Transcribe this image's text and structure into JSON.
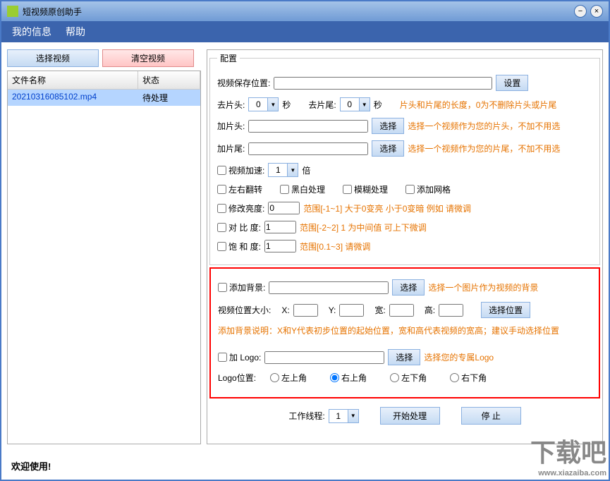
{
  "app": {
    "title": "短视频原创助手"
  },
  "menu": {
    "info": "我的信息",
    "help": "帮助"
  },
  "left": {
    "select_video": "选择视频",
    "clear_video": "清空视频",
    "col_filename": "文件名称",
    "col_status": "状态",
    "file_name": "20210316085102.mp4",
    "file_status": "待处理"
  },
  "cfg": {
    "legend": "配置",
    "save_path_label": "视频保存位置:",
    "save_path": "",
    "set_btn": "设置",
    "cut_head_label": "去片头:",
    "cut_head_val": "0",
    "sec": "秒",
    "cut_tail_label": "去片尾:",
    "cut_tail_val": "0",
    "cut_hint": "片头和片尾的长度，0为不删除片头或片尾",
    "add_head_label": "加片头:",
    "add_head_val": "",
    "select_btn": "选择",
    "add_head_hint": "选择一个视频作为您的片头，不加不用选",
    "add_tail_label": "加片尾:",
    "add_tail_val": "",
    "add_tail_hint": "选择一个视频作为您的片尾，不加不用选",
    "speed_label": "视频加速:",
    "speed_val": "1",
    "speed_unit": "倍",
    "flip": "左右翻转",
    "bw": "黑白处理",
    "blur": "模糊处理",
    "grid": "添加网格",
    "brightness_label": "修改亮度:",
    "brightness_val": "0",
    "brightness_hint": "范围[-1~1]    大于0变亮 小于0变暗  例如 请微调",
    "contrast_label": "对 比  度:",
    "contrast_val": "1",
    "contrast_hint": "范围[-2~2]   1 为中间值  可上下微调",
    "saturate_label": "饱 和 度:",
    "saturate_val": "1",
    "saturate_hint": "范围[0.1~3]   请微调",
    "add_bg_label": "添加背景:",
    "add_bg_val": "",
    "add_bg_hint": "选择一个图片作为视频的背景",
    "pos_size_label": "视频位置大小:",
    "x_label": "X:",
    "y_label": "Y:",
    "w_label": "宽:",
    "h_label": "高:",
    "x": "",
    "y": "",
    "w": "",
    "h": "",
    "pos_btn": "选择位置",
    "bg_note": "添加背景说明：X和Y代表初步位置的起始位置，宽和高代表视频的宽高；建议手动选择位置",
    "add_logo_label": "加 Logo:",
    "add_logo_val": "",
    "add_logo_hint": "选择您的专属Logo",
    "logo_pos_label": "Logo位置:",
    "r_tl": "左上角",
    "r_tr": "右上角",
    "r_bl": "左下角",
    "r_br": "右下角",
    "threads_label": "工作线程:",
    "threads_val": "1",
    "start_btn": "开始处理",
    "stop_btn": "停    止"
  },
  "footer": "欢迎使用!",
  "watermark": {
    "main": "下载吧",
    "sub": "www.xiazaiba.com"
  }
}
